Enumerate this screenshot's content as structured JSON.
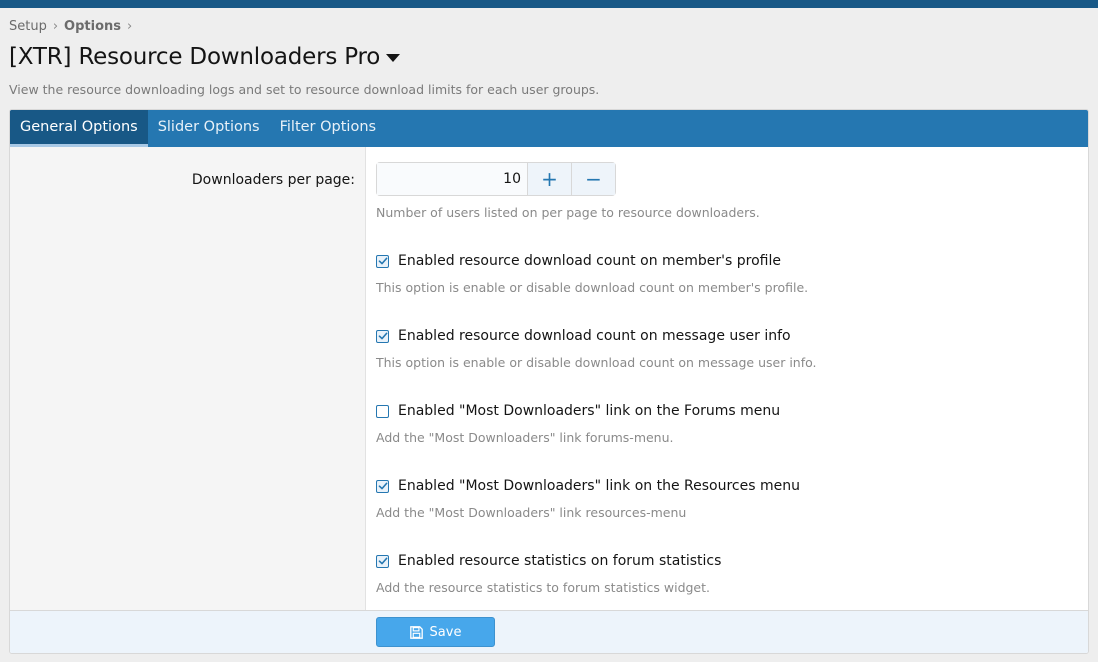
{
  "breadcrumb": {
    "items": [
      "Setup",
      "Options"
    ]
  },
  "title": "[XTR] Resource Downloaders Pro",
  "description": "View the resource downloading logs and set to resource download limits for each user groups.",
  "tabs": [
    {
      "label": "General Options",
      "active": true
    },
    {
      "label": "Slider Options",
      "active": false
    },
    {
      "label": "Filter Options",
      "active": false
    }
  ],
  "per_page": {
    "label": "Downloaders per page:",
    "value": "10",
    "hint": "Number of users listed on per page to resource downloaders."
  },
  "options": [
    {
      "label": "Enabled resource download count on member's profile",
      "checked": true,
      "hint": "This option is enable or disable download count on member's profile."
    },
    {
      "label": "Enabled resource download count on message user info",
      "checked": true,
      "hint": "This option is enable or disable download count on message user info."
    },
    {
      "label": "Enabled \"Most Downloaders\" link on the Forums menu",
      "checked": false,
      "hint": "Add the \"Most Downloaders\" link forums-menu."
    },
    {
      "label": "Enabled \"Most Downloaders\" link on the Resources menu",
      "checked": true,
      "hint": "Add the \"Most Downloaders\" link resources-menu"
    },
    {
      "label": "Enabled resource statistics on forum statistics",
      "checked": true,
      "hint": "Add the resource statistics to forum statistics widget."
    }
  ],
  "save_label": "Save",
  "colors": {
    "header": "#185886",
    "tabs": "#2577b1",
    "save": "#47a7eb"
  }
}
